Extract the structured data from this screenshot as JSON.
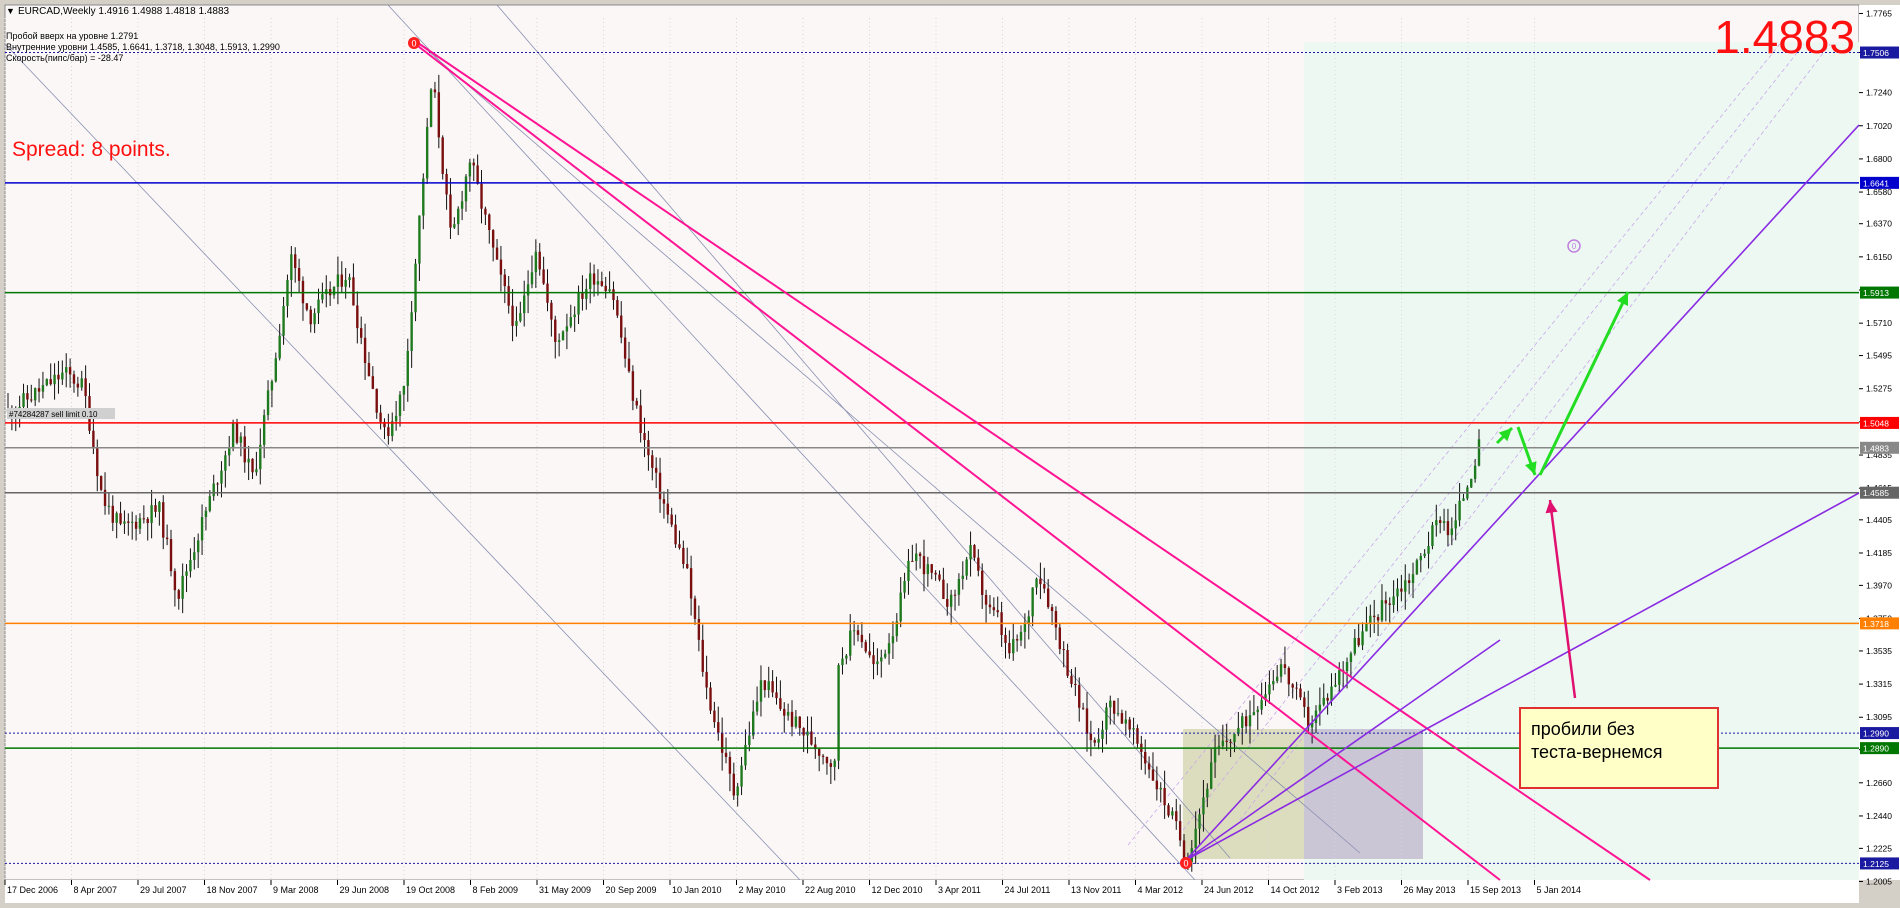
{
  "window": {
    "symbol_info": "EURCAD,Weekly  1.4916 1.4988 1.4818 1.4883",
    "menu_arrow": "triangle-down-icon"
  },
  "info_lines": [
    "Пробой вверх на уровне 1.2791",
    "Внутренние уровни 1.4585, 1.6641, 1.3718, 1.3048, 1.5913, 1.2990",
    "Скорость(пипс/бар) = -28.47"
  ],
  "big_price": "1.4883",
  "spread_text": "Spread: 8 points.",
  "order_label": "#74284287 sell limit 0.10",
  "annotation": {
    "line1": "пробили без",
    "line2": "теста-вернемся"
  },
  "fractal_marker": "0",
  "colors": {
    "plot_bg": "#fbf7f7",
    "bull": "#1f7a1f",
    "bear": "#7a0f0f",
    "blue_level": "#0000cc",
    "green_level": "#007700",
    "red_level": "#ff0000",
    "orange_level": "#ff8000",
    "gray_level": "#808080",
    "magenta": "#ff1493",
    "purple": "#8a2be2",
    "green_arrow": "#22dd22",
    "pink_arrow": "#e0106e"
  },
  "chart_data": {
    "type": "candlestick",
    "symbol": "EURCAD",
    "timeframe": "Weekly",
    "ylim": [
      1.2015,
      1.7735
    ],
    "y_ticks": [
      "1.7765",
      "1.7506",
      "1.7240",
      "1.7020",
      "1.6800",
      "1.6580",
      "1.6370",
      "1.6150",
      "1.5930",
      "1.5710",
      "1.5495",
      "1.5275",
      "1.5055",
      "1.4835",
      "1.4615",
      "1.4405",
      "1.4185",
      "1.3970",
      "1.3750",
      "1.3535",
      "1.3315",
      "1.3095",
      "1.2880",
      "1.2660",
      "1.2440",
      "1.2225",
      "1.2005"
    ],
    "x_ticks": [
      "17 Dec 2006",
      "8 Apr 2007",
      "29 Jul 2007",
      "18 Nov 2007",
      "9 Mar 2008",
      "29 Jun 2008",
      "19 Oct 2008",
      "8 Feb 2009",
      "31 May 2009",
      "20 Sep 2009",
      "10 Jan 2010",
      "2 May 2010",
      "22 Aug 2010",
      "12 Dec 2010",
      "3 Apr 2011",
      "24 Jul 2011",
      "13 Nov 2011",
      "4 Mar 2012",
      "24 Jun 2012",
      "14 Oct 2012",
      "3 Feb 2013",
      "26 May 2013",
      "15 Sep 2013",
      "5 Jan 2014"
    ],
    "price_path": [
      [
        1.512,
        0
      ],
      [
        1.538,
        0.03
      ],
      [
        1.529,
        0.04
      ],
      [
        1.455,
        0.05
      ],
      [
        1.434,
        0.06
      ],
      [
        1.448,
        0.08
      ],
      [
        1.39,
        0.09
      ],
      [
        1.465,
        0.11
      ],
      [
        1.502,
        0.12
      ],
      [
        1.468,
        0.13
      ],
      [
        1.535,
        0.14
      ],
      [
        1.615,
        0.15
      ],
      [
        1.575,
        0.16
      ],
      [
        1.605,
        0.18
      ],
      [
        1.545,
        0.19
      ],
      [
        1.495,
        0.2
      ],
      [
        1.528,
        0.21
      ],
      [
        1.735,
        0.225
      ],
      [
        1.625,
        0.235
      ],
      [
        1.68,
        0.245
      ],
      [
        1.605,
        0.26
      ],
      [
        1.565,
        0.27
      ],
      [
        1.623,
        0.28
      ],
      [
        1.558,
        0.29
      ],
      [
        1.603,
        0.31
      ],
      [
        1.595,
        0.32
      ],
      [
        1.53,
        0.33
      ],
      [
        1.48,
        0.34
      ],
      [
        1.405,
        0.36
      ],
      [
        1.33,
        0.37
      ],
      [
        1.259,
        0.385
      ],
      [
        1.335,
        0.4
      ],
      [
        1.315,
        0.41
      ],
      [
        1.275,
        0.44
      ],
      [
        1.418,
        0.42
      ],
      [
        1.345,
        0.44
      ],
      [
        1.37,
        0.45
      ],
      [
        1.34,
        0.46
      ],
      [
        1.37,
        0.47
      ],
      [
        1.42,
        0.48
      ],
      [
        1.385,
        0.5
      ],
      [
        1.42,
        0.51
      ],
      [
        1.38,
        0.52
      ],
      [
        1.375,
        0.525
      ],
      [
        1.35,
        0.53
      ],
      [
        1.37,
        0.54
      ],
      [
        1.408,
        0.545
      ],
      [
        1.395,
        0.55
      ],
      [
        1.35,
        0.56
      ],
      [
        1.29,
        0.575
      ],
      [
        1.32,
        0.585
      ],
      [
        1.29,
        0.6
      ],
      [
        1.235,
        0.62
      ],
      [
        1.215,
        0.625
      ],
      [
        1.285,
        0.64
      ],
      [
        1.305,
        0.655
      ],
      [
        1.345,
        0.675
      ],
      [
        1.305,
        0.69
      ],
      [
        1.325,
        0.7
      ],
      [
        1.36,
        0.715
      ],
      [
        1.385,
        0.73
      ],
      [
        1.405,
        0.745
      ],
      [
        1.445,
        0.76
      ],
      [
        1.43,
        0.765
      ],
      [
        1.47,
        0.775
      ],
      [
        1.4883,
        0.78
      ]
    ],
    "candle_count": 380,
    "horizontal_levels": [
      {
        "price": 1.7506,
        "label": "1.7506",
        "style": "dotted",
        "color": "#1a1aa0"
      },
      {
        "price": 1.6641,
        "label": "1.6641",
        "style": "solid",
        "color": "#0000cc"
      },
      {
        "price": 1.5913,
        "label": "1.5913",
        "style": "solid",
        "color": "#007700"
      },
      {
        "price": 1.5048,
        "label": "1.5048",
        "style": "solid",
        "color": "#ff0000"
      },
      {
        "price": 1.4883,
        "label": "1.4883",
        "style": "solid",
        "color": "#888888"
      },
      {
        "price": 1.4585,
        "label": "1.4585",
        "style": "solid",
        "color": "#666666"
      },
      {
        "price": 1.3718,
        "label": "1.3718",
        "style": "solid",
        "color": "#ff8000"
      },
      {
        "price": 1.299,
        "label": "1.2990",
        "style": "dotted",
        "color": "#1a1aa0"
      },
      {
        "price": 1.289,
        "label": "1.2890",
        "style": "solid",
        "color": "#007700"
      },
      {
        "price": 1.2125,
        "label": "1.2125",
        "style": "dotted",
        "color": "#1a1aa0"
      }
    ],
    "price_axis_labels": [
      "1.7506",
      "1.6641",
      "1.5913",
      "1.5048",
      "1.4883",
      "1.4585",
      "1.3718",
      "1.2990",
      "1.2890",
      "1.2125"
    ],
    "grid": true,
    "legend": "none"
  }
}
